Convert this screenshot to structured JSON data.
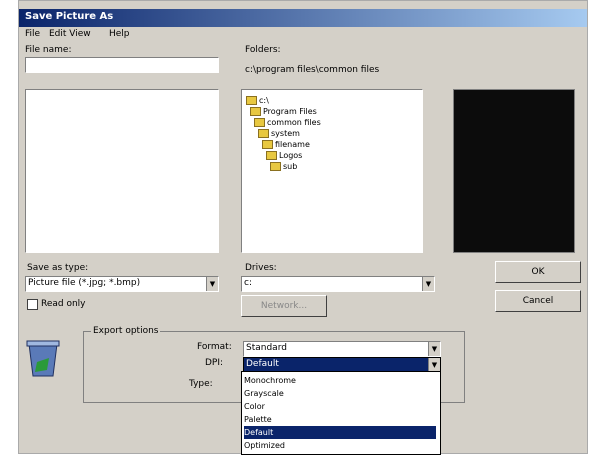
{
  "window": {
    "title": "Save Picture As"
  },
  "menu": [
    "File",
    "Edit View",
    "Help"
  ],
  "left": {
    "filename_label": "File name:",
    "filename_value": "",
    "files_list": [],
    "list_type_label": "Save as type:",
    "list_type_value": "Picture file (*.jpg; *.bmp)",
    "read_only_label": "Read only"
  },
  "right": {
    "folders_label": "Folders:",
    "current_path": "c:\\program files\\common files",
    "tree": [
      "c:\\",
      "Program Files",
      "common files",
      "system",
      "filename",
      "Logos",
      "sub"
    ],
    "drives_label": "Drives:",
    "drives_value": "c:",
    "network_label": "Network..."
  },
  "buttons": {
    "ok": "OK",
    "cancel": "Cancel"
  },
  "options": {
    "group_label": "Export options",
    "format_label": "Format:",
    "format_value": "Standard",
    "res_label": "DPI:",
    "res_value": "Default",
    "type_label": "Type:",
    "list": [
      "Monochrome",
      "Grayscale",
      "Color",
      "Palette",
      "Default",
      "Optimized"
    ],
    "selected_index": 4
  },
  "colors": {
    "title_start": "#0a246a",
    "title_end": "#a6caf0",
    "preview_bg": "#0c0c0c"
  }
}
